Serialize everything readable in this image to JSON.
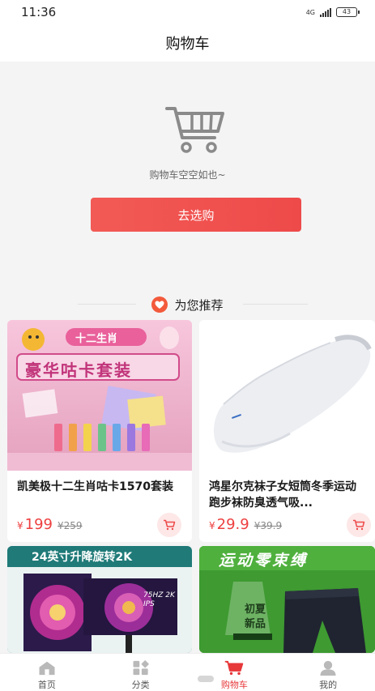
{
  "status_bar": {
    "time": "11:36",
    "network": "4G",
    "battery": "43"
  },
  "header": {
    "title": "购物车"
  },
  "empty_cart": {
    "message": "购物车空空如也~",
    "button_label": "去选购"
  },
  "recommend": {
    "title": "为您推荐"
  },
  "products": [
    {
      "title": "凯美极十二生肖咕卡1570套装",
      "price": "199",
      "currency": "¥",
      "old_price": "¥259",
      "image_text_1": "十二生肖",
      "image_text_2": "豪华咕卡套装"
    },
    {
      "title": "鸿星尔克袜子女短筒冬季运动跑步袜防臭透气吸...",
      "price": "29.9",
      "currency": "¥",
      "old_price": "¥39.9",
      "image_text_1": "",
      "image_text_2": ""
    },
    {
      "title": "",
      "price": "",
      "currency": "",
      "old_price": "",
      "image_text_1": "24英寸升降旋转2K",
      "image_text_2": "75HZ 2K IPS"
    },
    {
      "title": "",
      "price": "",
      "currency": "",
      "old_price": "",
      "image_text_1": "运动零束缚",
      "image_text_2": "初夏新品"
    }
  ],
  "tab_bar": {
    "items": [
      {
        "label": "首页",
        "icon": "home-icon"
      },
      {
        "label": "分类",
        "icon": "category-icon"
      },
      {
        "label": "购物车",
        "icon": "cart-icon"
      },
      {
        "label": "我的",
        "icon": "profile-icon"
      }
    ],
    "active": "购物车"
  },
  "colors": {
    "accent": "#ee4a4a",
    "background": "#f4f4f4"
  }
}
